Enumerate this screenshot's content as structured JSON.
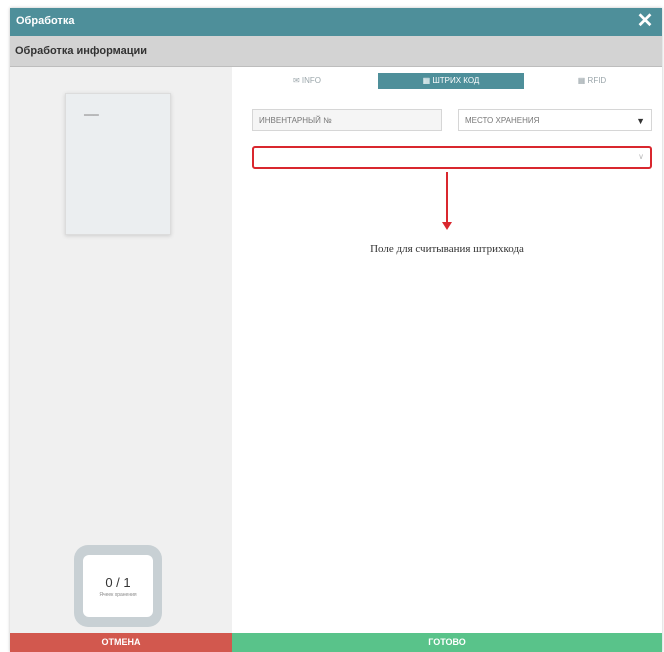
{
  "window": {
    "title": "Обработка"
  },
  "subheader": {
    "title": "Обработка информации"
  },
  "left": {
    "doc_label": "═══",
    "counter": {
      "value": "0 / 1",
      "caption": "Ячеек хранения"
    }
  },
  "tabs": [
    {
      "label": "✉ INFO",
      "icon": "rfid-icon"
    },
    {
      "label": "▦ ШТРИХ КОД",
      "icon": "barcode-icon"
    },
    {
      "label": "▦ RFID",
      "icon": "rfid-tag-icon"
    }
  ],
  "fields": {
    "inventory": {
      "placeholder": "ИНВЕНТАРНЫЙ №"
    },
    "storage": {
      "value": "МЕСТО ХРАНЕНИЯ",
      "arrow": "▼"
    }
  },
  "barcode": {
    "value": "",
    "hint_icon": "∨"
  },
  "annotation": {
    "text": "Поле для считывания штрихкода"
  },
  "buttons": {
    "cancel": "ОТМЕНА",
    "ok": "ГОТОВО"
  },
  "colors": {
    "accent": "#4e8f9a",
    "cancel": "#d2584e",
    "ok": "#59c38a",
    "highlight": "#d9272e"
  }
}
